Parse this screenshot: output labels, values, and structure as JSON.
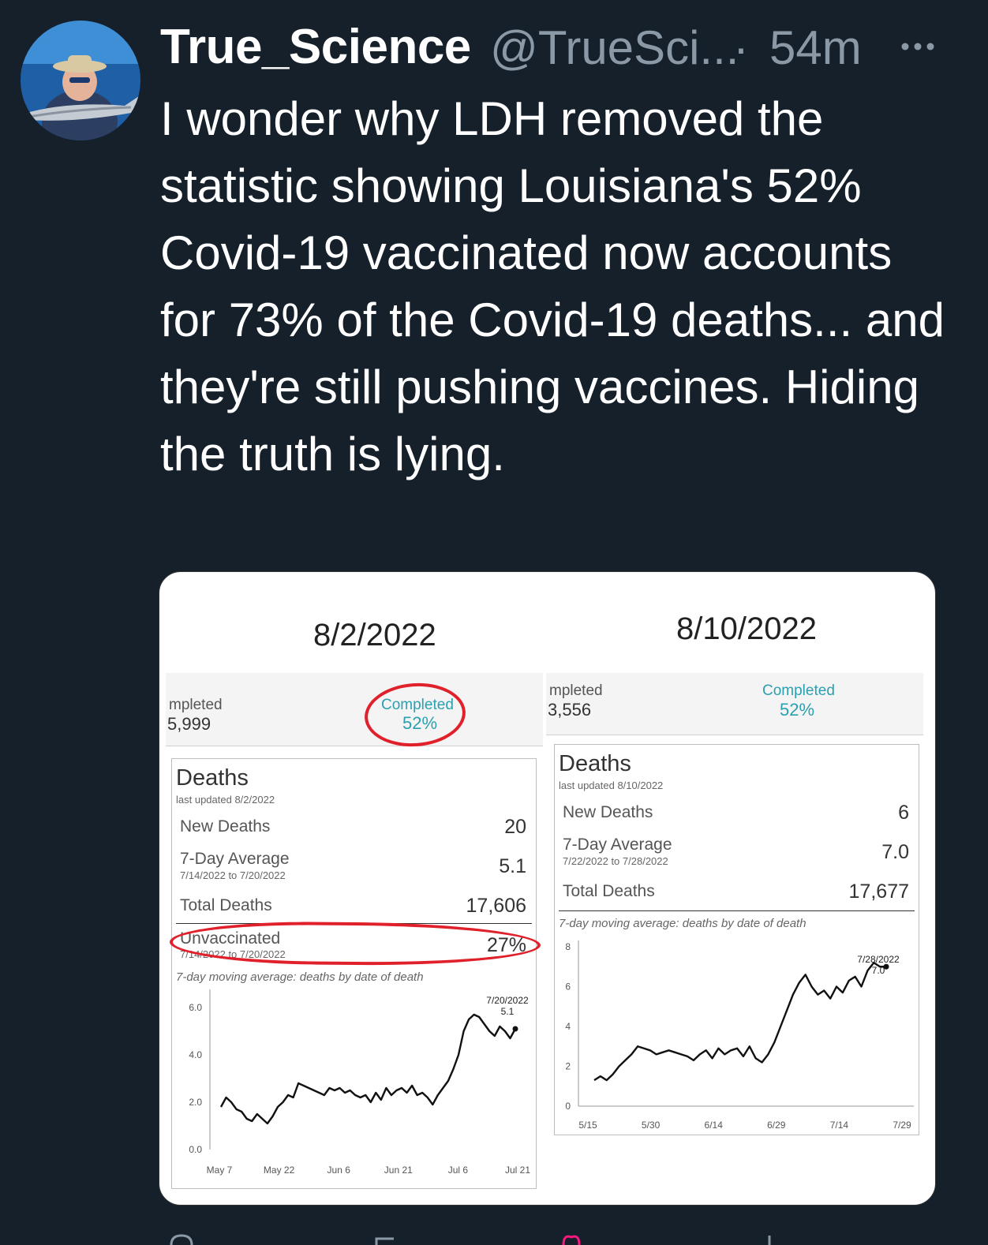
{
  "tweet": {
    "display_name": "True_Science",
    "handle": "@TrueSci...",
    "separator": "·",
    "time": "54m",
    "more_icon": "more-horizontal-icon",
    "text": "I wonder why LDH removed the statistic showing Louisiana's 52% Covid-19 vaccinated now accounts for 73% of the Covid-19 deaths... and they're still pushing vaccines.  Hiding the truth is lying."
  },
  "left_panel": {
    "date": "8/2/2022",
    "strip_left_label": "mpleted",
    "strip_left_value": "5,999",
    "completed_label": "Completed",
    "completed_value": "52%",
    "deaths_title": "Deaths",
    "last_updated": "last updated 8/2/2022",
    "new_deaths_label": "New Deaths",
    "new_deaths_value": "20",
    "avg_label": "7-Day Average",
    "avg_range": "7/14/2022 to 7/20/2022",
    "avg_value": "5.1",
    "total_label": "Total Deaths",
    "total_value": "17,606",
    "unvax_label": "Unvaccinated",
    "unvax_range": "7/14/2022 to 7/20/2022",
    "unvax_value": "27%",
    "chart_caption": "7-day moving average: deaths by date of death",
    "callout_date": "7/20/2022",
    "callout_value": "5.1"
  },
  "right_panel": {
    "date": "8/10/2022",
    "strip_left_label": "mpleted",
    "strip_left_value": "3,556",
    "completed_label": "Completed",
    "completed_value": "52%",
    "deaths_title": "Deaths",
    "last_updated": "last updated 8/10/2022",
    "new_deaths_label": "New Deaths",
    "new_deaths_value": "6",
    "avg_label": "7-Day Average",
    "avg_range": "7/22/2022 to 7/28/2022",
    "avg_value": "7.0",
    "total_label": "Total Deaths",
    "total_value": "17,677",
    "chart_caption": "7-day moving average: deaths by date of death",
    "callout_date": "7/28/2022",
    "callout_value": "7.0"
  },
  "chart_data": [
    {
      "type": "line",
      "ylim": [
        0,
        6.5
      ],
      "yticks": [
        "0.0",
        "2.0",
        "4.0",
        "6.0"
      ],
      "xticks": [
        "May 7",
        "May 22",
        "Jun 6",
        "Jun 21",
        "Jul 6",
        "Jul 21"
      ],
      "values": [
        1.8,
        2.2,
        2.0,
        1.7,
        1.6,
        1.3,
        1.2,
        1.5,
        1.3,
        1.1,
        1.4,
        1.8,
        2.0,
        2.3,
        2.2,
        2.8,
        2.7,
        2.6,
        2.5,
        2.4,
        2.3,
        2.6,
        2.5,
        2.6,
        2.4,
        2.5,
        2.3,
        2.2,
        2.3,
        2.0,
        2.4,
        2.1,
        2.6,
        2.3,
        2.5,
        2.6,
        2.4,
        2.7,
        2.3,
        2.4,
        2.2,
        1.9,
        2.3,
        2.6,
        2.9,
        3.4,
        4.0,
        5.0,
        5.5,
        5.7,
        5.6,
        5.3,
        5.0,
        4.8,
        5.2,
        5.0,
        4.7,
        5.1
      ],
      "callout": {
        "date": "7/20/2022",
        "value": 5.1
      }
    },
    {
      "type": "line",
      "ylim": [
        0,
        8
      ],
      "yticks": [
        "0",
        "2",
        "4",
        "6",
        "8"
      ],
      "xticks": [
        "5/15",
        "5/30",
        "6/14",
        "6/29",
        "7/14",
        "7/29"
      ],
      "values": [
        1.3,
        1.5,
        1.3,
        1.6,
        2.0,
        2.3,
        2.6,
        3.0,
        2.9,
        2.8,
        2.6,
        2.7,
        2.8,
        2.7,
        2.6,
        2.5,
        2.3,
        2.6,
        2.8,
        2.4,
        2.9,
        2.6,
        2.8,
        2.9,
        2.5,
        3.0,
        2.4,
        2.2,
        2.6,
        3.2,
        4.0,
        4.8,
        5.6,
        6.2,
        6.6,
        6.0,
        5.6,
        5.8,
        5.4,
        6.0,
        5.7,
        6.3,
        6.5,
        6.0,
        6.8,
        7.2,
        7.0,
        7.0
      ],
      "callout": {
        "date": "7/28/2022",
        "value": 7.0
      }
    }
  ]
}
